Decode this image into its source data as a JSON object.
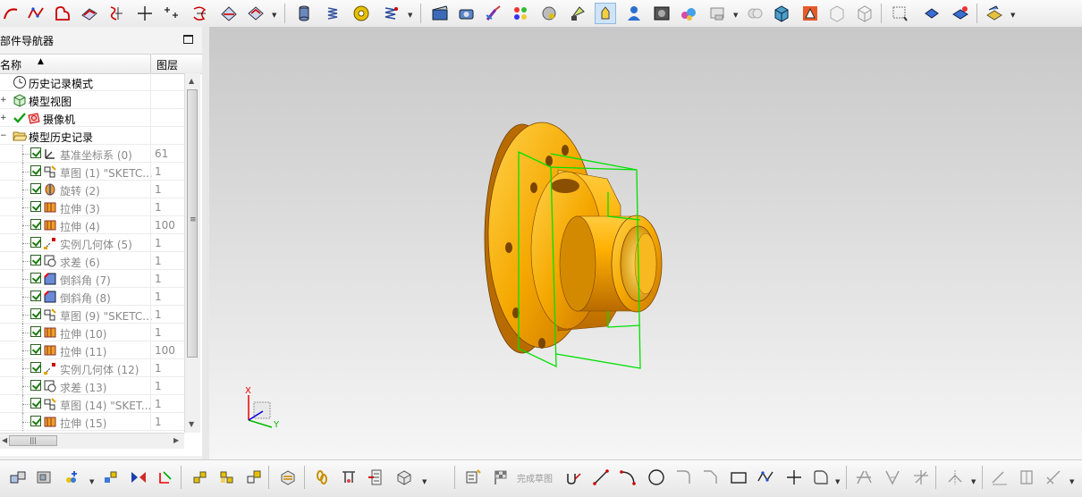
{
  "navigator": {
    "title": "部件导航器",
    "columns": {
      "name": "名称",
      "layer": "图层"
    },
    "top_items": [
      {
        "label": "历史记录模式"
      },
      {
        "label": "模型视图"
      },
      {
        "label": "摄像机"
      },
      {
        "label": "模型历史记录"
      }
    ],
    "features": [
      {
        "label": "基准坐标系 (0)",
        "layer": "61"
      },
      {
        "label": "草图 (1) \"SKETC...",
        "layer": "1"
      },
      {
        "label": "旋转 (2)",
        "layer": "1"
      },
      {
        "label": "拉伸 (3)",
        "layer": "1"
      },
      {
        "label": "拉伸 (4)",
        "layer": "100"
      },
      {
        "label": "实例几何体 (5)",
        "layer": "1"
      },
      {
        "label": "求差 (6)",
        "layer": "1"
      },
      {
        "label": "倒斜角 (7)",
        "layer": "1"
      },
      {
        "label": "倒斜角 (8)",
        "layer": "1"
      },
      {
        "label": "草图 (9) \"SKETC...",
        "layer": "1"
      },
      {
        "label": "拉伸 (10)",
        "layer": "1"
      },
      {
        "label": "拉伸 (11)",
        "layer": "100"
      },
      {
        "label": "实例几何体 (12)",
        "layer": "1"
      },
      {
        "label": "求差 (13)",
        "layer": "1"
      },
      {
        "label": "草图 (14) \"SKET...",
        "layer": "1"
      },
      {
        "label": "拉伸 (15)",
        "layer": "1"
      }
    ]
  },
  "viewport": {
    "triad": {
      "x_label": "X",
      "y_label": "Y"
    },
    "part_color": "#f2a800",
    "sketch_color": "#00e000"
  },
  "bottom_toolbar": {
    "finish_sketch_label": "完成草图"
  },
  "colors": {
    "accent": "#cfe4f7",
    "check_green": "#1c7a12"
  }
}
